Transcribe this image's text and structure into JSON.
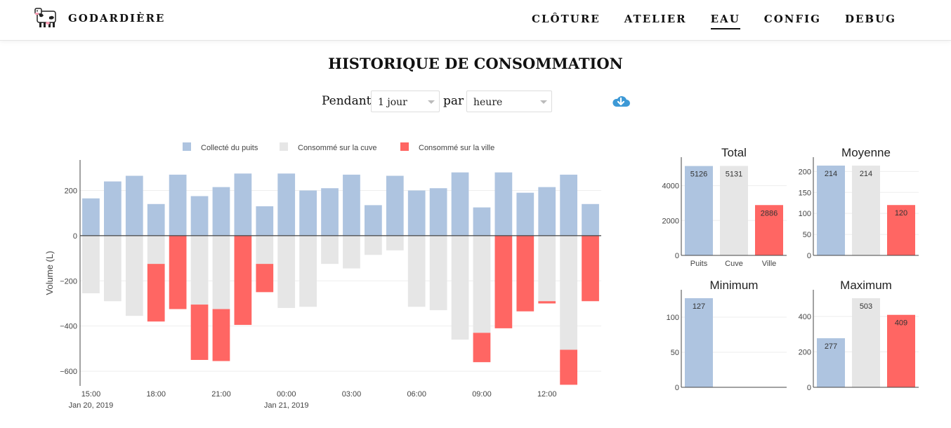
{
  "brand": {
    "name": "GODARDIÈRE",
    "logo_icon": "cow-icon"
  },
  "nav": {
    "items": [
      "CLÔTURE",
      "ATELIER",
      "EAU",
      "CONFIG",
      "DEBUG"
    ],
    "active": "EAU"
  },
  "page": {
    "title": "HISTORIQUE DE CONSOMMATION"
  },
  "controls": {
    "period_label": "Pendant",
    "period_value": "1 jour",
    "group_label": "par",
    "group_value": "heure",
    "download_icon": "cloud-download-icon",
    "download_color": "#3d99d6"
  },
  "colors": {
    "puits": "#aec4e0",
    "cuve": "#e6e6e6",
    "ville": "#ff6663"
  },
  "chart_data": [
    {
      "type": "bar",
      "ylabel": "Volume (L)",
      "ylim": [
        -665,
        335
      ],
      "yticks": [
        200,
        0,
        -200,
        -400,
        -600
      ],
      "legend": [
        "Collecté du puits",
        "Consommé sur la cuve",
        "Consommé sur la ville"
      ],
      "legend_position": "top",
      "x_tick_labels": [
        {
          "label": "15:00",
          "sub": "Jan 20, 2019",
          "at": 0
        },
        {
          "label": "18:00",
          "at": 3
        },
        {
          "label": "21:00",
          "at": 6
        },
        {
          "label": "00:00",
          "sub": "Jan 21, 2019",
          "at": 9
        },
        {
          "label": "03:00",
          "at": 12
        },
        {
          "label": "06:00",
          "at": 15
        },
        {
          "label": "09:00",
          "at": 18
        },
        {
          "label": "12:00",
          "at": 21
        }
      ],
      "series": [
        {
          "name": "Collecté du puits",
          "values": [
            165,
            240,
            265,
            140,
            270,
            175,
            215,
            275,
            130,
            275,
            200,
            210,
            270,
            135,
            265,
            200,
            210,
            280,
            125,
            280,
            190,
            215,
            270,
            140
          ]
        },
        {
          "name": "Consommé sur la cuve",
          "values": [
            -255,
            -290,
            -355,
            -125,
            0,
            -305,
            -325,
            0,
            -125,
            -320,
            -315,
            -125,
            -145,
            -85,
            -65,
            -315,
            -330,
            -460,
            -430,
            0,
            0,
            -290,
            -505,
            0
          ]
        },
        {
          "name": "Consommé sur la ville",
          "values": [
            0,
            0,
            0,
            -255,
            -325,
            -245,
            -230,
            -395,
            -125,
            0,
            0,
            0,
            0,
            0,
            0,
            0,
            0,
            0,
            -130,
            -410,
            -335,
            -10,
            -155,
            -290
          ]
        }
      ]
    },
    {
      "type": "bar",
      "title": "Total",
      "categories": [
        "Puits",
        "Cuve",
        "Ville"
      ],
      "values": [
        5126,
        5131,
        2886
      ],
      "ylim": [
        0,
        5150
      ],
      "yticks": [
        0,
        2000,
        4000
      ]
    },
    {
      "type": "bar",
      "title": "Moyenne",
      "categories": [
        "Puits",
        "Cuve",
        "Ville"
      ],
      "values": [
        214,
        214,
        120
      ],
      "ylim": [
        0,
        214
      ],
      "yticks": [
        0,
        50,
        100,
        150,
        200
      ]
    },
    {
      "type": "bar",
      "title": "Minimum",
      "categories": [
        "Puits",
        "Cuve",
        "Ville"
      ],
      "values": [
        127,
        null,
        null
      ],
      "ylim": [
        0,
        127
      ],
      "yticks": [
        0,
        50,
        100
      ]
    },
    {
      "type": "bar",
      "title": "Maximum",
      "categories": [
        "Puits",
        "Cuve",
        "Ville"
      ],
      "values": [
        277,
        503,
        409
      ],
      "ylim": [
        0,
        503
      ],
      "yticks": [
        0,
        200,
        400
      ]
    }
  ]
}
